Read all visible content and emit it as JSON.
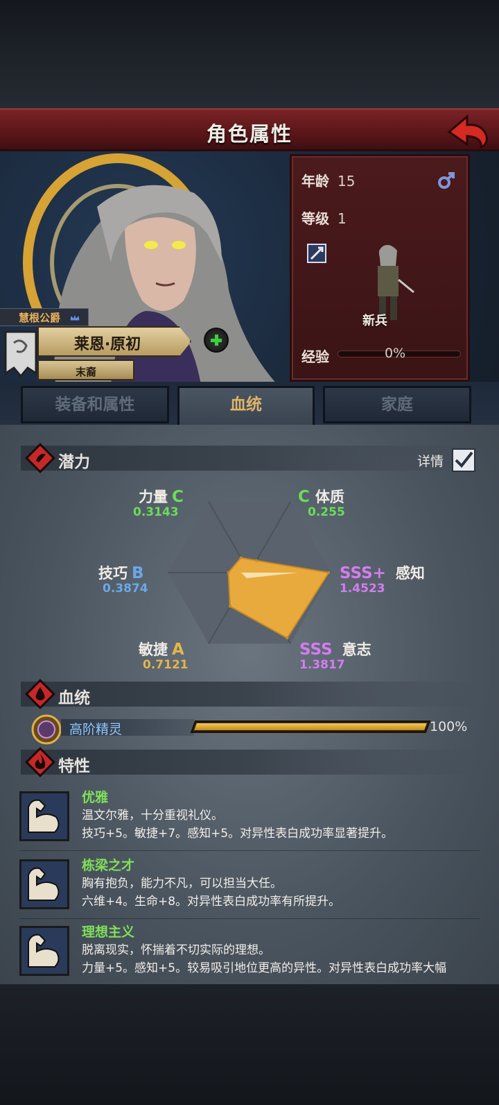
{
  "header": {
    "title": "角色属性"
  },
  "hero": {
    "noble_title": "慧根公爵",
    "name": "莱恩·原初",
    "rank": "末裔"
  },
  "info": {
    "age_label": "年龄",
    "age": "15",
    "level_label": "等级",
    "level": "1",
    "class_name": "新兵",
    "exp_label": "经验",
    "exp_value": "0%",
    "exp_progress": 0
  },
  "tabs": [
    {
      "label": "装备和属性"
    },
    {
      "label": "血统"
    },
    {
      "label": "家庭"
    }
  ],
  "potential": {
    "section_label": "潜力",
    "detail_label": "详情",
    "stats": [
      {
        "name": "力量",
        "grade": "C",
        "value": "0.3143",
        "color": "#6bdc5a"
      },
      {
        "name": "体质",
        "grade": "C",
        "value": "0.255",
        "color": "#6bdc5a"
      },
      {
        "name": "感知",
        "grade": "SSS+",
        "value": "1.4523",
        "color": "#d57cf0"
      },
      {
        "name": "意志",
        "grade": "SSS",
        "value": "1.3817",
        "color": "#d57cf0"
      },
      {
        "name": "敏捷",
        "grade": "A",
        "value": "0.7121",
        "color": "#e2b64a"
      },
      {
        "name": "技巧",
        "grade": "B",
        "value": "0.3874",
        "color": "#6aa8e8"
      }
    ]
  },
  "chart_data": {
    "type": "radar",
    "categories": [
      "力量",
      "体质",
      "感知",
      "意志",
      "敏捷",
      "技巧"
    ],
    "values": [
      0.3143,
      0.255,
      1.4523,
      1.3817,
      0.7121,
      0.3874
    ],
    "grades": [
      "C",
      "C",
      "SSS+",
      "SSS",
      "A",
      "B"
    ],
    "fill_color": "#e9aa3d"
  },
  "bloodline": {
    "section_label": "血统",
    "name": "高阶精灵",
    "percent_label": "100%",
    "progress": 1.0
  },
  "traits": {
    "section_label": "特性",
    "items": [
      {
        "name": "优雅",
        "desc": "温文尔雅，十分重视礼仪。",
        "effect": "技巧+5。敏捷+7。感知+5。对异性表白成功率显著提升。"
      },
      {
        "name": "栋梁之才",
        "desc": "胸有抱负，能力不凡，可以担当大任。",
        "effect": "六维+4。生命+8。对异性表白成功率有所提升。"
      },
      {
        "name": "理想主义",
        "desc": "脱离现实，怀揣着不切实际的理想。",
        "effect": "力量+5。感知+5。较易吸引地位更高的异性。对异性表白成功率大幅"
      }
    ]
  }
}
